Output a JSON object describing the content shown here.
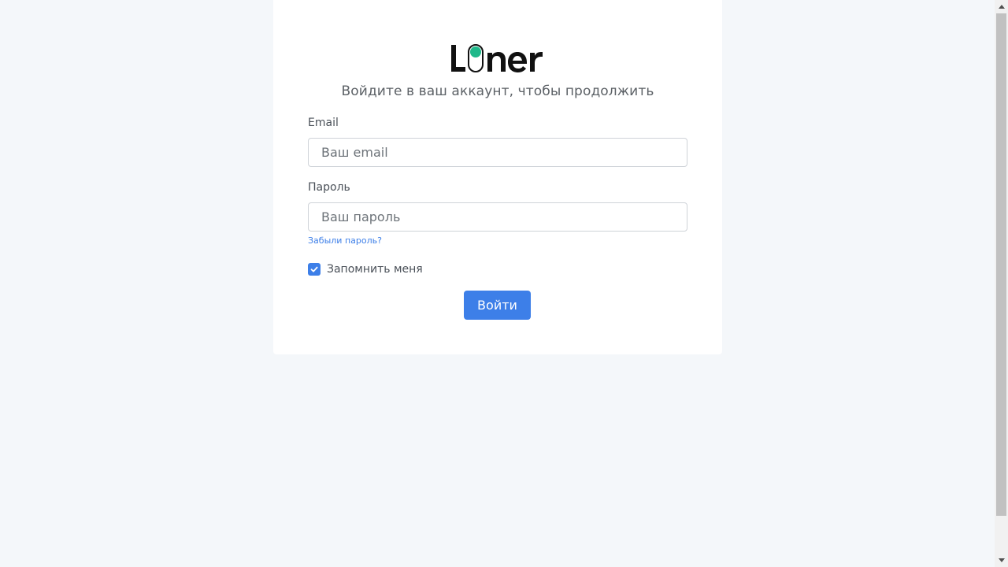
{
  "brand": {
    "name": "Liner",
    "accent_color": "#1fb88a",
    "text_color": "#111111"
  },
  "login": {
    "subtitle": "Войдите в ваш аккаунт, чтобы продолжить",
    "email": {
      "label": "Email",
      "placeholder": "Ваш email",
      "value": ""
    },
    "password": {
      "label": "Пароль",
      "placeholder": "Ваш пароль",
      "value": ""
    },
    "forgot_password": "Забыли пароль?",
    "remember_me": {
      "label": "Запомнить меня",
      "checked": true
    },
    "submit_label": "Войти"
  },
  "colors": {
    "primary": "#3d7fe8",
    "background": "#f4f7fa",
    "card": "#ffffff"
  },
  "icons": {
    "checkbox": "check-icon",
    "scroll_up": "chevron-up-icon",
    "scroll_down": "chevron-down-icon"
  }
}
